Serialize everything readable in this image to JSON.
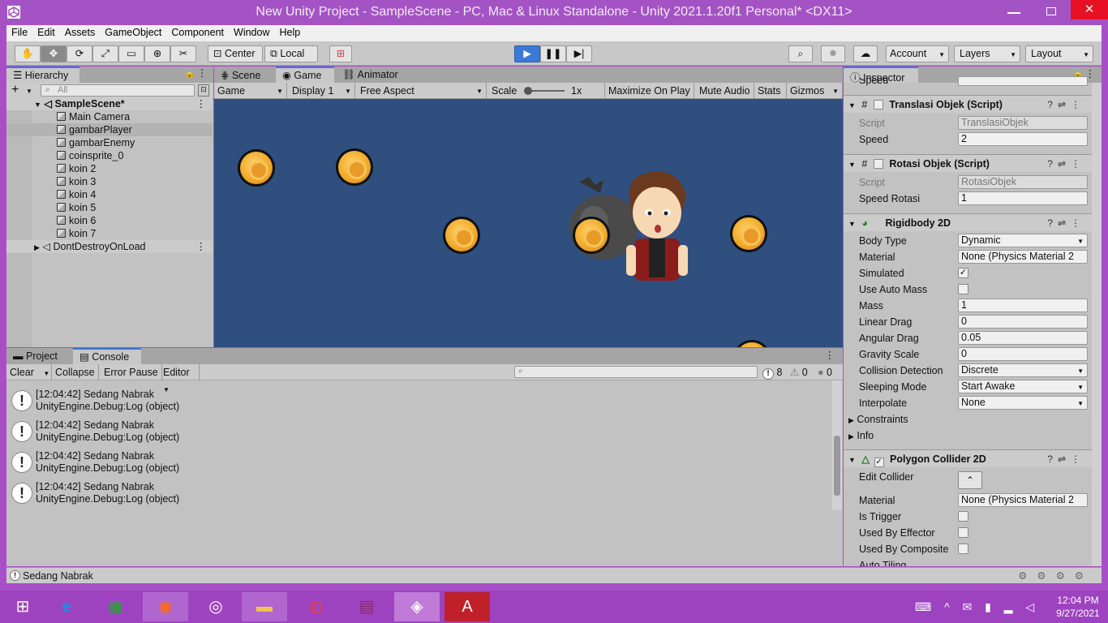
{
  "window": {
    "title": "New Unity Project - SampleScene - PC, Mac & Linux Standalone - Unity 2021.1.20f1 Personal* <DX11>",
    "close": "✕"
  },
  "menu": [
    "File",
    "Edit",
    "Assets",
    "GameObject",
    "Component",
    "Window",
    "Help"
  ],
  "toolbar": {
    "center": "Center",
    "local": "Local",
    "account": "Account",
    "layers": "Layers",
    "layout": "Layout"
  },
  "hierarchy": {
    "tab": "Hierarchy",
    "search_placeholder": "All",
    "scene": "SampleScene*",
    "items": [
      "Main Camera",
      "gambarPlayer",
      "gambarEnemy",
      "coinsprite_0",
      "koin 2",
      "koin 3",
      "koin 4",
      "koin 5",
      "koin 6",
      "koin 7"
    ],
    "dontdestroy": "DontDestroyOnLoad"
  },
  "viewtabs": {
    "scene": "Scene",
    "game": "Game",
    "animator": "Animator"
  },
  "gamebar": {
    "game": "Game",
    "display": "Display 1",
    "aspect": "Free Aspect",
    "scale": "Scale",
    "scale_val": "1x",
    "maximize": "Maximize On Play",
    "mute": "Mute Audio",
    "stats": "Stats",
    "gizmos": "Gizmos"
  },
  "bottomtabs": {
    "project": "Project",
    "console": "Console"
  },
  "console": {
    "clear": "Clear",
    "collapse": "Collapse",
    "errorpause": "Error Pause",
    "editor": "Editor",
    "count_warn": "8",
    "count_err1": "0",
    "count_err2": "0",
    "entries": [
      {
        "line1": "[12:04:42] Sedang Nabrak",
        "line2": "UnityEngine.Debug:Log (object)"
      },
      {
        "line1": "[12:04:42] Sedang Nabrak",
        "line2": "UnityEngine.Debug:Log (object)"
      },
      {
        "line1": "[12:04:42] Sedang Nabrak",
        "line2": "UnityEngine.Debug:Log (object)"
      },
      {
        "line1": "[12:04:42] Sedang Nabrak",
        "line2": "UnityEngine.Debug:Log (object)"
      }
    ]
  },
  "status": {
    "text": "Sedang Nabrak"
  },
  "inspector": {
    "tab": "Inspector",
    "speed_top": "Speed",
    "translasi": {
      "title": "Translasi Objek (Script)",
      "script_label": "Script",
      "script_val": "TranslasiObjek",
      "speed_label": "Speed",
      "speed_val": "2"
    },
    "rotasi": {
      "title": "Rotasi Objek (Script)",
      "script_label": "Script",
      "script_val": "RotasiObjek",
      "speed_label": "Speed Rotasi",
      "speed_val": "1"
    },
    "rigidbody": {
      "title": "Rigidbody 2D",
      "body_type": "Body Type",
      "body_type_val": "Dynamic",
      "material": "Material",
      "material_val": "None (Physics Material 2",
      "simulated": "Simulated",
      "auto_mass": "Use Auto Mass",
      "mass": "Mass",
      "mass_val": "1",
      "linear": "Linear Drag",
      "linear_val": "0",
      "angular": "Angular Drag",
      "angular_val": "0.05",
      "gravity": "Gravity Scale",
      "gravity_val": "0",
      "collision": "Collision Detection",
      "collision_val": "Discrete",
      "sleeping": "Sleeping Mode",
      "sleeping_val": "Start Awake",
      "interpolate": "Interpolate",
      "interpolate_val": "None",
      "constraints": "Constraints",
      "info": "Info"
    },
    "polygon": {
      "title": "Polygon Collider 2D",
      "edit": "Edit Collider",
      "material": "Material",
      "material_val": "None (Physics Material 2",
      "trigger": "Is Trigger",
      "effector": "Used By Effector",
      "composite": "Used By Composite",
      "tiling": "Auto Tiling"
    }
  },
  "clock": {
    "time": "12:04 PM",
    "date": "9/27/2021"
  }
}
